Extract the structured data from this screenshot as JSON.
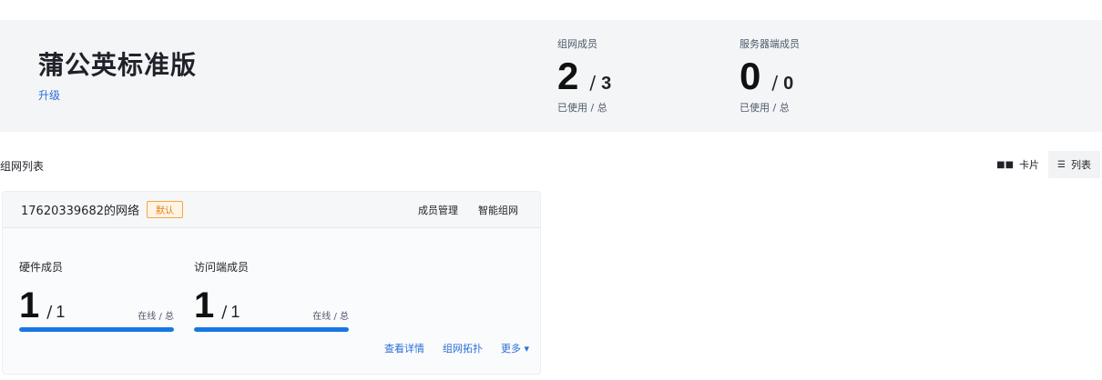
{
  "plan": {
    "name": "蒲公英标准版",
    "upgrade_label": "升级"
  },
  "stats": [
    {
      "label": "组网成员",
      "value": "2",
      "total": "3",
      "sub": "已使用 / 总"
    },
    {
      "label": "服务器端成员",
      "value": "0",
      "total": "0",
      "sub": "已使用 / 总"
    }
  ],
  "section": {
    "title": "组网列表"
  },
  "view_toggle": {
    "card_label": "卡片",
    "list_label": "列表",
    "card_icon": "grid-icon",
    "list_icon": "list-icon"
  },
  "network": {
    "name": "17620339682的网络",
    "badge": "默认",
    "actions": [
      "成员管理",
      "智能组网"
    ],
    "metrics": [
      {
        "label": "硬件成员",
        "value": "1",
        "total": "1",
        "sub": "在线 / 总",
        "progress": 1.0
      },
      {
        "label": "访问端成员",
        "value": "1",
        "total": "1",
        "sub": "在线 / 总",
        "progress": 1.0
      }
    ],
    "footer_actions": [
      "查看详情",
      "组网拓扑",
      "更多"
    ]
  },
  "colors": {
    "accent": "#1677e5",
    "link": "#2b6fd6",
    "badge_border": "#f5a347",
    "panel_bg": "#f4f5f7"
  }
}
